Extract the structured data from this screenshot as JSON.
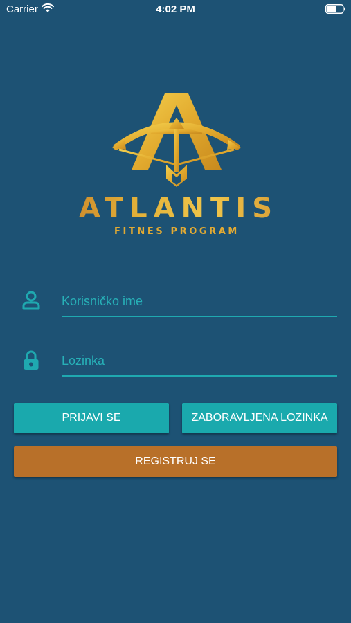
{
  "status_bar": {
    "carrier": "Carrier",
    "time": "4:02 PM",
    "wifi_icon": "wifi-icon",
    "battery_icon": "battery-icon"
  },
  "brand": {
    "name": "ATLANTIS",
    "subtitle": "FITNES PROGRAM",
    "logo_icon": "atlantis-logo-icon",
    "gold": "#e2aa33",
    "copper": "#b8651e"
  },
  "login_form": {
    "username": {
      "placeholder": "Korisničko ime",
      "value": "",
      "icon": "user-icon"
    },
    "password": {
      "placeholder": "Lozinka",
      "value": "",
      "icon": "lock-icon"
    }
  },
  "buttons": {
    "login_label": "PRIJAVI SE",
    "forgot_label": "ZABORAVLJENA LOZINKA",
    "register_label": "REGISTRUJ SE"
  },
  "colors": {
    "background": "#1d5274",
    "accent_teal": "#1aa9ad",
    "register_orange": "#b87029",
    "text": "#ffffff"
  }
}
